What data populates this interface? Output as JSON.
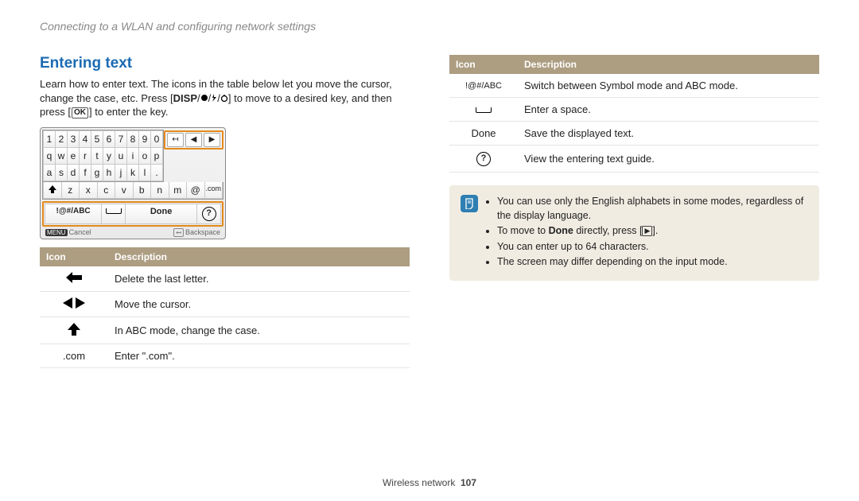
{
  "breadcrumb": "Connecting to a WLAN and configuring network settings",
  "section_title": "Entering text",
  "intro_part1": "Learn how to enter text. The icons in the table below let you move the cursor, change the case, etc. Press [",
  "intro_disp": "DISP",
  "intro_part2": "] to move to a desired key, and then press [",
  "intro_ok": "OK",
  "intro_part3": "] to enter the key.",
  "keyboard": {
    "nav": [
      "↤",
      "◀",
      "▶"
    ],
    "row1": [
      "1",
      "2",
      "3",
      "4",
      "5",
      "6",
      "7",
      "8",
      "9",
      "0"
    ],
    "row2": [
      "q",
      "w",
      "e",
      "r",
      "t",
      "y",
      "u",
      "i",
      "o",
      "p"
    ],
    "row3": [
      "a",
      "s",
      "d",
      "f",
      "g",
      "h",
      "j",
      "k",
      "l",
      "."
    ],
    "row4_shift": "⇧",
    "row4_keys": [
      "z",
      "x",
      "c",
      "v",
      "b",
      "n",
      "m",
      "@"
    ],
    "row4_com": ".com",
    "row5_sym": "!@#/ABC",
    "row5_space": "␣",
    "row5_done": "Done",
    "row5_help": "?",
    "footer_menu": "MENU",
    "footer_cancel": "Cancel",
    "footer_backspace": "Backspace"
  },
  "table_header_icon": "Icon",
  "table_header_desc": "Description",
  "left_rows": [
    {
      "icon_name": "backspace-arrow-icon",
      "desc": "Delete the last letter."
    },
    {
      "icon_name": "move-cursor-icon",
      "desc": "Move the cursor."
    },
    {
      "icon_name": "shift-icon",
      "desc": "In ABC mode, change the case."
    },
    {
      "icon_name": "com-icon",
      "icon_text": ".com",
      "desc": "Enter \".com\"."
    }
  ],
  "right_rows": [
    {
      "icon_name": "symbol-abc-icon",
      "icon_text": "!@#/ABC",
      "desc": "Switch between Symbol mode and ABC mode."
    },
    {
      "icon_name": "space-icon",
      "desc": "Enter a space."
    },
    {
      "icon_name": "done-icon",
      "icon_text": "Done",
      "desc": "Save the displayed text."
    },
    {
      "icon_name": "help-icon",
      "icon_text": "?",
      "desc": "View the entering text guide."
    }
  ],
  "notes": {
    "li1": "You can use only the English alphabets in some modes, regardless of the display language.",
    "li2a": "To move to ",
    "li2b": "Done",
    "li2c": " directly, press [",
    "li2d": "].",
    "li3": "You can enter up to 64 characters.",
    "li4": "The screen may differ depending on the input mode."
  },
  "footer_section": "Wireless network",
  "footer_page": "107"
}
